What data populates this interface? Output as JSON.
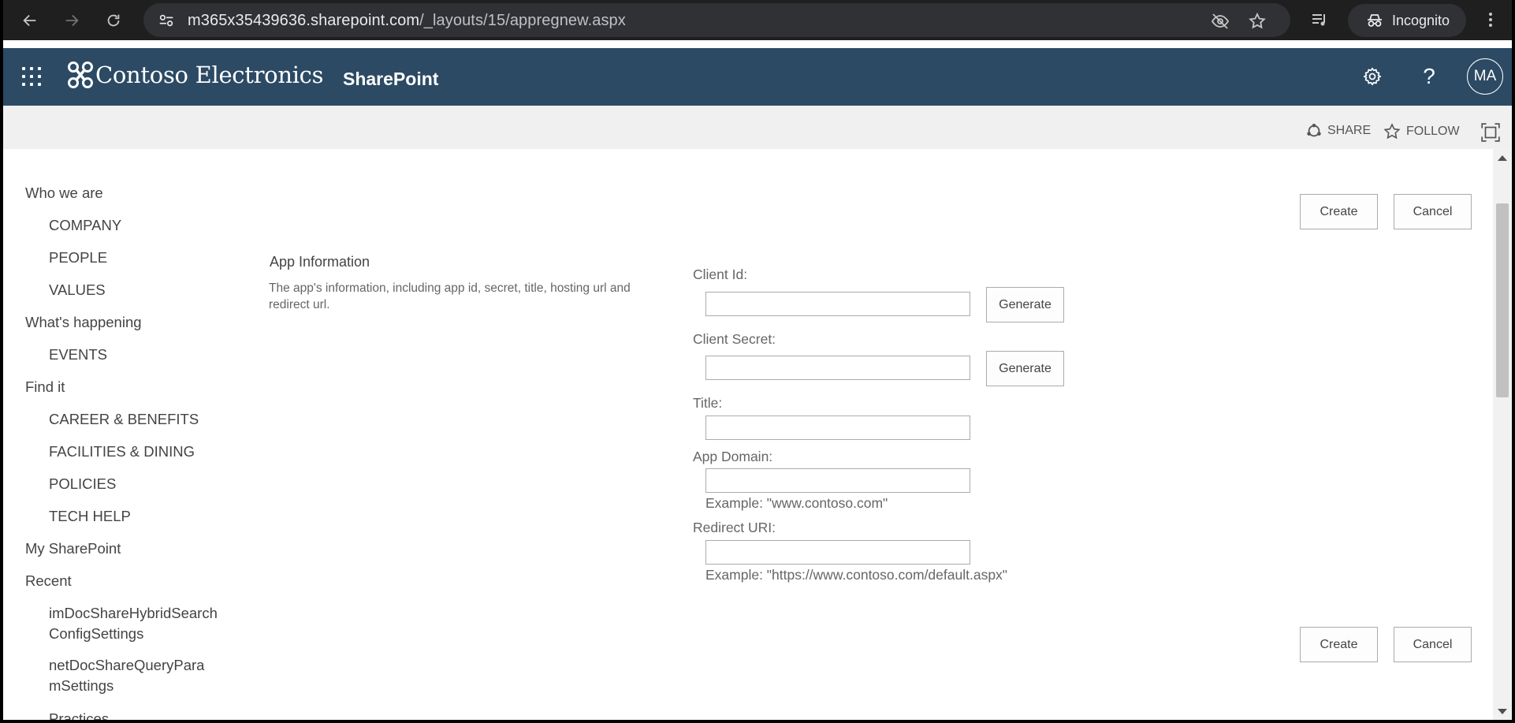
{
  "browser": {
    "url_host": "m365x35439636.sharepoint.com",
    "url_path": "/_layouts/15/appregnew.aspx",
    "incognito_label": "Incognito",
    "icons": [
      "back-icon",
      "forward-icon",
      "reload-icon",
      "site-info-icon",
      "eye-off-icon",
      "star-icon",
      "media-icon",
      "incognito-icon",
      "more-icon"
    ]
  },
  "suitebar": {
    "brand": "Contoso Electronics",
    "app": "SharePoint",
    "avatar_initials": "MA",
    "color": "#2c4a64"
  },
  "ribbon": {
    "share": "SHARE",
    "follow": "FOLLOW"
  },
  "leftnav": {
    "items": [
      {
        "label": "Who we are"
      },
      {
        "label": "COMPANY"
      },
      {
        "label": "PEOPLE"
      },
      {
        "label": "VALUES"
      },
      {
        "label": "What's happening"
      },
      {
        "label": "EVENTS"
      },
      {
        "label": "Find it"
      },
      {
        "label": "CAREER & BENEFITS"
      },
      {
        "label": "FACILITIES & DINING"
      },
      {
        "label": "POLICIES"
      },
      {
        "label": "TECH HELP"
      },
      {
        "label": "My SharePoint"
      },
      {
        "label": "Recent"
      },
      {
        "label": "imDocShareHybridSearchConfigSettings"
      },
      {
        "label": "netDocShareQueryParamSettings"
      },
      {
        "label": "Practices"
      }
    ]
  },
  "form": {
    "create_label": "Create",
    "cancel_label": "Cancel",
    "section_title": "App Information",
    "section_desc": "The app's information, including app id, secret, title, hosting url and redirect url.",
    "generate_label": "Generate",
    "client_id_label": "Client Id:",
    "client_id_value": "",
    "client_secret_label": "Client Secret:",
    "client_secret_value": "",
    "title_label": "Title:",
    "title_value": "",
    "app_domain_label": "App Domain:",
    "app_domain_value": "",
    "app_domain_example": "Example: \"www.contoso.com\"",
    "redirect_label": "Redirect URI:",
    "redirect_value": "",
    "redirect_example": "Example: \"https://www.contoso.com/default.aspx\""
  }
}
